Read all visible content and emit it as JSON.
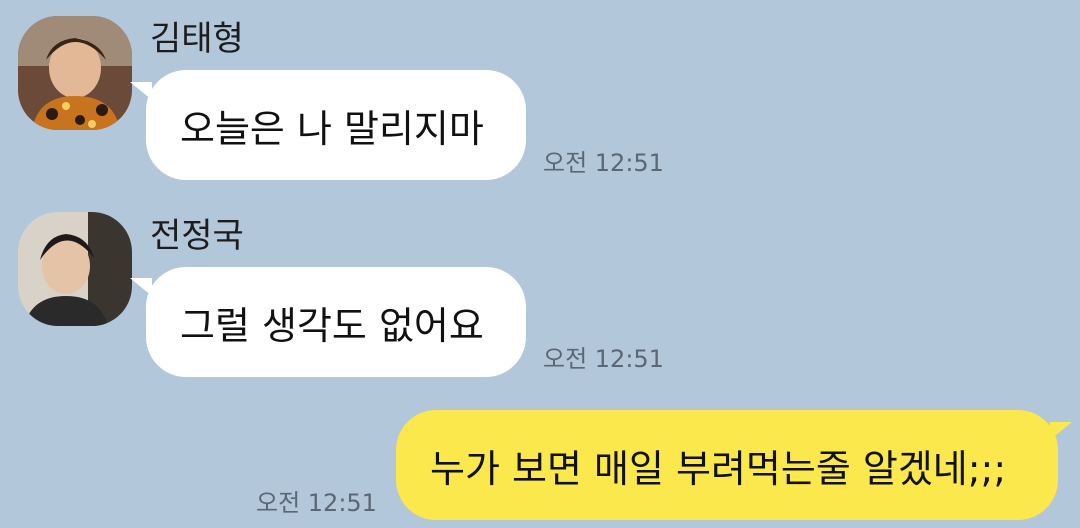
{
  "messages": [
    {
      "sender": "김태형",
      "text": "오늘은 나 말리지마",
      "time": "오전 12:51",
      "direction": "incoming",
      "avatar": "person-avatar-icon"
    },
    {
      "sender": "전정국",
      "text": "그럴 생각도 없어요",
      "time": "오전 12:51",
      "direction": "incoming",
      "avatar": "person-avatar-icon"
    },
    {
      "text": "누가 보면 매일 부려먹는줄 알겠네;;;",
      "time": "오전 12:51",
      "direction": "outgoing"
    }
  ],
  "colors": {
    "background": "#b2c7d9",
    "incoming_bubble": "#ffffff",
    "outgoing_bubble": "#fbe84c",
    "time_text": "#5b6774"
  }
}
